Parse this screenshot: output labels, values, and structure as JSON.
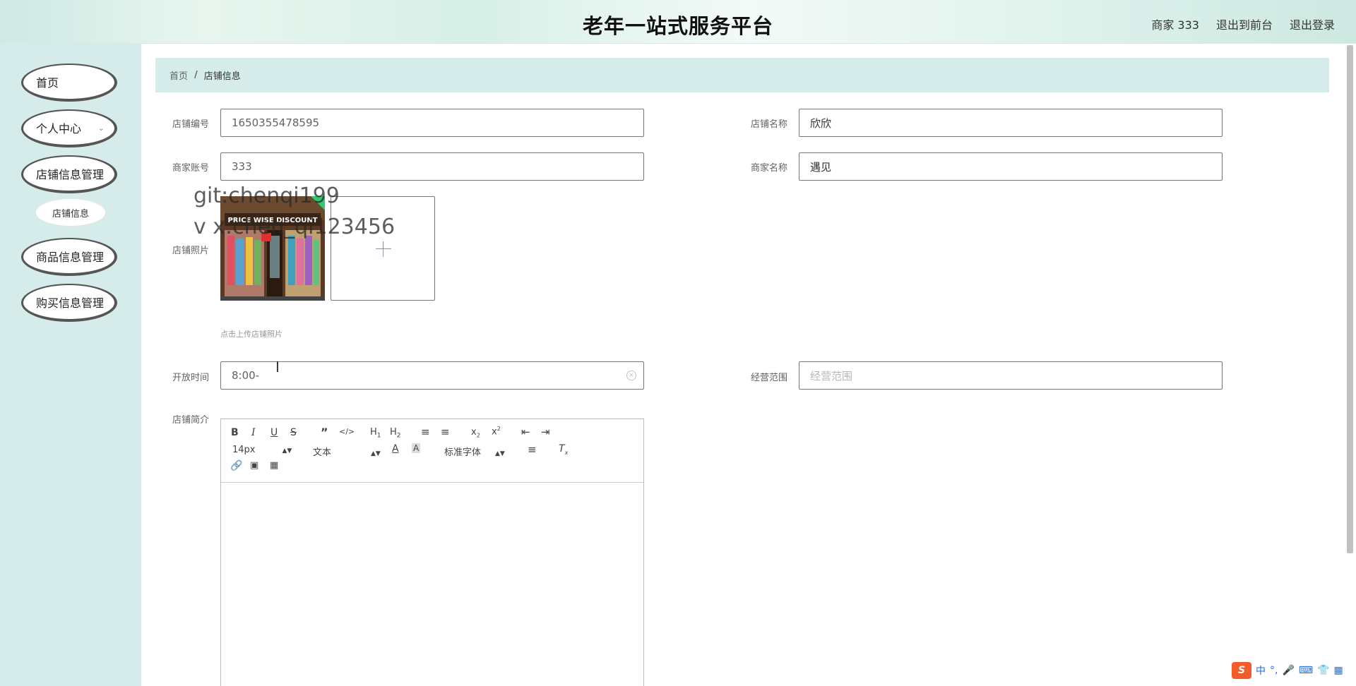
{
  "header": {
    "title": "老年一站式服务平台",
    "merchant": "商家 333",
    "exit_front": "退出到前台",
    "logout": "退出登录"
  },
  "sidebar": {
    "items": [
      {
        "label": "首页"
      },
      {
        "label": "个人中心"
      },
      {
        "label": "店铺信息管理"
      },
      {
        "label": "商品信息管理"
      },
      {
        "label": "购买信息管理"
      }
    ],
    "sub_item": "店铺信息"
  },
  "breadcrumb": {
    "home": "首页",
    "separator": "/",
    "current": "店铺信息"
  },
  "form": {
    "shop_no_label": "店铺编号",
    "shop_no_value": "1650355478595",
    "shop_name_label": "店铺名称",
    "shop_name_value": "欣欣",
    "merchant_account_label": "商家账号",
    "merchant_account_value": "333",
    "merchant_name_label": "商家名称",
    "merchant_name_value": "遇见",
    "photo_label": "店铺照片",
    "photo_hint": "点击上传店铺照片",
    "photo_sign_text": "PRICE WISE DISCOUNT",
    "open_time_label": "开放时间",
    "open_time_value": "8:00-",
    "scope_label": "经营范围",
    "scope_placeholder": "经营范围",
    "intro_label": "店铺简介"
  },
  "watermark": {
    "line1": "git:chenqi199",
    "line2": "v x:chen_qi123456"
  },
  "editor": {
    "font_size": "14px",
    "paragraph": "文本",
    "font_family": "标准字体"
  },
  "ime": {
    "mode": "中"
  }
}
